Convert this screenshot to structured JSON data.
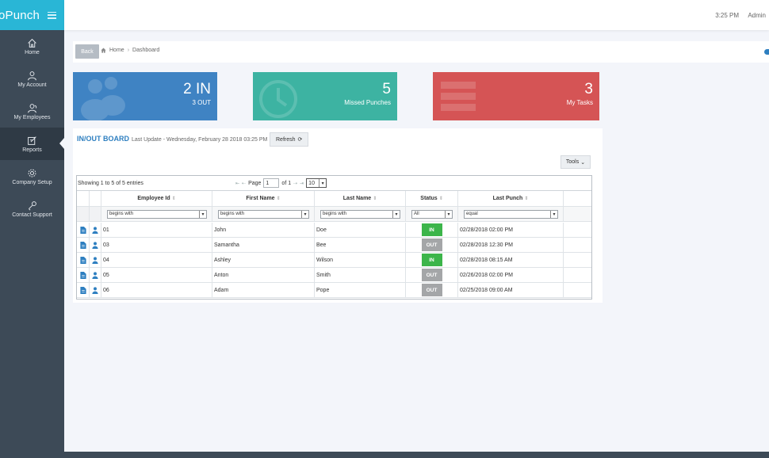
{
  "app": {
    "brand": "oPunch"
  },
  "nav": [
    {
      "label": "Home",
      "icon": "home-icon"
    },
    {
      "label": "My Account",
      "icon": "user-icon"
    },
    {
      "label": "My Employees",
      "icon": "employees-icon"
    },
    {
      "label": "Reports",
      "icon": "reports-icon",
      "active": true
    },
    {
      "label": "Company Setup",
      "icon": "gear-icon"
    },
    {
      "label": "Contact Support",
      "icon": "wrench-icon"
    }
  ],
  "topbar": {
    "time": "3:25 PM",
    "user": "Admin"
  },
  "breadcrumb": {
    "back": "Back",
    "home": "Home",
    "current": "Dashboard"
  },
  "tiles": [
    {
      "big": "2 IN",
      "sub": "3 OUT",
      "color": "#3f83c3"
    },
    {
      "big": "5",
      "sub": "Missed Punches",
      "color": "#3db3a2"
    },
    {
      "big": "3",
      "sub": "My Tasks",
      "color": "#d55455"
    }
  ],
  "board": {
    "title": "IN/OUT BOARD",
    "updated": "Last Update - Wednesday, February 28 2018 03:25 PM",
    "refresh": "Refresh",
    "tools": "Tools",
    "showing": "Showing 1 to 5 of 5 entries",
    "page_label": "Page",
    "page_value": "1",
    "of_label": "of 1",
    "page_size": "10",
    "columns": [
      "Employee Id",
      "First Name",
      "Last Name",
      "Status",
      "Last Punch"
    ],
    "filters": [
      "begins with",
      "begins with",
      "begins with",
      "All",
      "equal"
    ],
    "rows": [
      {
        "id": "01",
        "first": "John",
        "last": "Doe",
        "status": "IN",
        "punch": "02/28/2018 02:00 PM"
      },
      {
        "id": "03",
        "first": "Samantha",
        "last": "Bee",
        "status": "OUT",
        "punch": "02/28/2018 12:30 PM"
      },
      {
        "id": "04",
        "first": "Ashley",
        "last": "Wilson",
        "status": "IN",
        "punch": "02/28/2018 08:15 AM"
      },
      {
        "id": "05",
        "first": "Anton",
        "last": "Smith",
        "status": "OUT",
        "punch": "02/26/2018 02:00 PM"
      },
      {
        "id": "06",
        "first": "Adam",
        "last": "Pope",
        "status": "OUT",
        "punch": "02/25/2018 09:00 AM"
      }
    ]
  },
  "colors": {
    "accent": "#29b6d6",
    "status_in": "#3cb54a",
    "status_out": "#a4a6a8",
    "link": "#2e7fc0"
  }
}
